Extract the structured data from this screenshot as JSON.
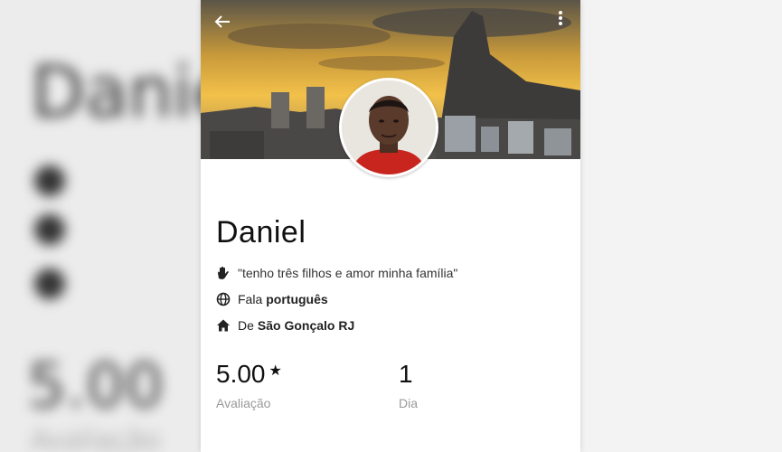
{
  "profile": {
    "name": "Daniel",
    "quote": "\"tenho três filhos e amor minha família\"",
    "language_prefix": "Fala",
    "language": "português",
    "hometown_prefix": "De",
    "hometown": "São Gonçalo RJ"
  },
  "stats": {
    "rating_value": "5.00",
    "rating_label": "Avaliação",
    "days_value": "1",
    "days_label": "Dia"
  },
  "icons": {
    "back": "arrow-left-icon",
    "more": "more-vertical-icon",
    "quote": "waving-hand-icon",
    "language": "globe-icon",
    "hometown": "home-icon",
    "rating": "star-icon"
  }
}
